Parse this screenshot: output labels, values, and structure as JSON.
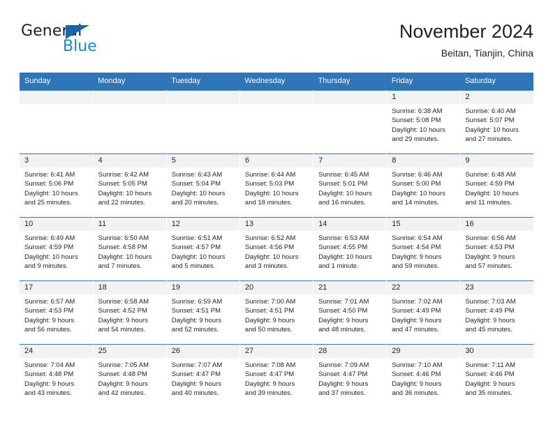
{
  "brand": {
    "name_part1": "General",
    "name_part2": "Blue",
    "color_dark": "#231f20",
    "color_blue": "#1b87c9",
    "triangle_color": "#1668ad"
  },
  "header": {
    "title": "November 2024",
    "subtitle": "Beitan, Tianjin, China"
  },
  "theme": {
    "header_bg": "#2e76b8",
    "daynum_bg": "#f2f2f2",
    "grid_line": "#2e76b8",
    "text": "#231f20"
  },
  "weekdays": [
    {
      "label": "Sunday"
    },
    {
      "label": "Monday"
    },
    {
      "label": "Tuesday"
    },
    {
      "label": "Wednesday"
    },
    {
      "label": "Thursday"
    },
    {
      "label": "Friday"
    },
    {
      "label": "Saturday"
    }
  ],
  "weeks": [
    [
      {
        "day": "",
        "blank": true,
        "sunrise": "",
        "sunset": "",
        "daylight": "",
        "daylight2": ""
      },
      {
        "day": "",
        "blank": true,
        "sunrise": "",
        "sunset": "",
        "daylight": "",
        "daylight2": ""
      },
      {
        "day": "",
        "blank": true,
        "sunrise": "",
        "sunset": "",
        "daylight": "",
        "daylight2": ""
      },
      {
        "day": "",
        "blank": true,
        "sunrise": "",
        "sunset": "",
        "daylight": "",
        "daylight2": ""
      },
      {
        "day": "",
        "blank": true,
        "sunrise": "",
        "sunset": "",
        "daylight": "",
        "daylight2": ""
      },
      {
        "day": "1",
        "blank": false,
        "sunrise": "Sunrise: 6:38 AM",
        "sunset": "Sunset: 5:08 PM",
        "daylight": "Daylight: 10 hours",
        "daylight2": "and 29 minutes."
      },
      {
        "day": "2",
        "blank": false,
        "sunrise": "Sunrise: 6:40 AM",
        "sunset": "Sunset: 5:07 PM",
        "daylight": "Daylight: 10 hours",
        "daylight2": "and 27 minutes."
      }
    ],
    [
      {
        "day": "3",
        "blank": false,
        "sunrise": "Sunrise: 6:41 AM",
        "sunset": "Sunset: 5:06 PM",
        "daylight": "Daylight: 10 hours",
        "daylight2": "and 25 minutes."
      },
      {
        "day": "4",
        "blank": false,
        "sunrise": "Sunrise: 6:42 AM",
        "sunset": "Sunset: 5:05 PM",
        "daylight": "Daylight: 10 hours",
        "daylight2": "and 22 minutes."
      },
      {
        "day": "5",
        "blank": false,
        "sunrise": "Sunrise: 6:43 AM",
        "sunset": "Sunset: 5:04 PM",
        "daylight": "Daylight: 10 hours",
        "daylight2": "and 20 minutes."
      },
      {
        "day": "6",
        "blank": false,
        "sunrise": "Sunrise: 6:44 AM",
        "sunset": "Sunset: 5:03 PM",
        "daylight": "Daylight: 10 hours",
        "daylight2": "and 18 minutes."
      },
      {
        "day": "7",
        "blank": false,
        "sunrise": "Sunrise: 6:45 AM",
        "sunset": "Sunset: 5:01 PM",
        "daylight": "Daylight: 10 hours",
        "daylight2": "and 16 minutes."
      },
      {
        "day": "8",
        "blank": false,
        "sunrise": "Sunrise: 6:46 AM",
        "sunset": "Sunset: 5:00 PM",
        "daylight": "Daylight: 10 hours",
        "daylight2": "and 14 minutes."
      },
      {
        "day": "9",
        "blank": false,
        "sunrise": "Sunrise: 6:48 AM",
        "sunset": "Sunset: 4:59 PM",
        "daylight": "Daylight: 10 hours",
        "daylight2": "and 11 minutes."
      }
    ],
    [
      {
        "day": "10",
        "blank": false,
        "sunrise": "Sunrise: 6:49 AM",
        "sunset": "Sunset: 4:59 PM",
        "daylight": "Daylight: 10 hours",
        "daylight2": "and 9 minutes."
      },
      {
        "day": "11",
        "blank": false,
        "sunrise": "Sunrise: 6:50 AM",
        "sunset": "Sunset: 4:58 PM",
        "daylight": "Daylight: 10 hours",
        "daylight2": "and 7 minutes."
      },
      {
        "day": "12",
        "blank": false,
        "sunrise": "Sunrise: 6:51 AM",
        "sunset": "Sunset: 4:57 PM",
        "daylight": "Daylight: 10 hours",
        "daylight2": "and 5 minutes."
      },
      {
        "day": "13",
        "blank": false,
        "sunrise": "Sunrise: 6:52 AM",
        "sunset": "Sunset: 4:56 PM",
        "daylight": "Daylight: 10 hours",
        "daylight2": "and 3 minutes."
      },
      {
        "day": "14",
        "blank": false,
        "sunrise": "Sunrise: 6:53 AM",
        "sunset": "Sunset: 4:55 PM",
        "daylight": "Daylight: 10 hours",
        "daylight2": "and 1 minute."
      },
      {
        "day": "15",
        "blank": false,
        "sunrise": "Sunrise: 6:54 AM",
        "sunset": "Sunset: 4:54 PM",
        "daylight": "Daylight: 9 hours",
        "daylight2": "and 59 minutes."
      },
      {
        "day": "16",
        "blank": false,
        "sunrise": "Sunrise: 6:56 AM",
        "sunset": "Sunset: 4:53 PM",
        "daylight": "Daylight: 9 hours",
        "daylight2": "and 57 minutes."
      }
    ],
    [
      {
        "day": "17",
        "blank": false,
        "sunrise": "Sunrise: 6:57 AM",
        "sunset": "Sunset: 4:53 PM",
        "daylight": "Daylight: 9 hours",
        "daylight2": "and 56 minutes."
      },
      {
        "day": "18",
        "blank": false,
        "sunrise": "Sunrise: 6:58 AM",
        "sunset": "Sunset: 4:52 PM",
        "daylight": "Daylight: 9 hours",
        "daylight2": "and 54 minutes."
      },
      {
        "day": "19",
        "blank": false,
        "sunrise": "Sunrise: 6:59 AM",
        "sunset": "Sunset: 4:51 PM",
        "daylight": "Daylight: 9 hours",
        "daylight2": "and 52 minutes."
      },
      {
        "day": "20",
        "blank": false,
        "sunrise": "Sunrise: 7:00 AM",
        "sunset": "Sunset: 4:51 PM",
        "daylight": "Daylight: 9 hours",
        "daylight2": "and 50 minutes."
      },
      {
        "day": "21",
        "blank": false,
        "sunrise": "Sunrise: 7:01 AM",
        "sunset": "Sunset: 4:50 PM",
        "daylight": "Daylight: 9 hours",
        "daylight2": "and 48 minutes."
      },
      {
        "day": "22",
        "blank": false,
        "sunrise": "Sunrise: 7:02 AM",
        "sunset": "Sunset: 4:49 PM",
        "daylight": "Daylight: 9 hours",
        "daylight2": "and 47 minutes."
      },
      {
        "day": "23",
        "blank": false,
        "sunrise": "Sunrise: 7:03 AM",
        "sunset": "Sunset: 4:49 PM",
        "daylight": "Daylight: 9 hours",
        "daylight2": "and 45 minutes."
      }
    ],
    [
      {
        "day": "24",
        "blank": false,
        "sunrise": "Sunrise: 7:04 AM",
        "sunset": "Sunset: 4:48 PM",
        "daylight": "Daylight: 9 hours",
        "daylight2": "and 43 minutes."
      },
      {
        "day": "25",
        "blank": false,
        "sunrise": "Sunrise: 7:05 AM",
        "sunset": "Sunset: 4:48 PM",
        "daylight": "Daylight: 9 hours",
        "daylight2": "and 42 minutes."
      },
      {
        "day": "26",
        "blank": false,
        "sunrise": "Sunrise: 7:07 AM",
        "sunset": "Sunset: 4:47 PM",
        "daylight": "Daylight: 9 hours",
        "daylight2": "and 40 minutes."
      },
      {
        "day": "27",
        "blank": false,
        "sunrise": "Sunrise: 7:08 AM",
        "sunset": "Sunset: 4:47 PM",
        "daylight": "Daylight: 9 hours",
        "daylight2": "and 39 minutes."
      },
      {
        "day": "28",
        "blank": false,
        "sunrise": "Sunrise: 7:09 AM",
        "sunset": "Sunset: 4:47 PM",
        "daylight": "Daylight: 9 hours",
        "daylight2": "and 37 minutes."
      },
      {
        "day": "29",
        "blank": false,
        "sunrise": "Sunrise: 7:10 AM",
        "sunset": "Sunset: 4:46 PM",
        "daylight": "Daylight: 9 hours",
        "daylight2": "and 36 minutes."
      },
      {
        "day": "30",
        "blank": false,
        "sunrise": "Sunrise: 7:11 AM",
        "sunset": "Sunset: 4:46 PM",
        "daylight": "Daylight: 9 hours",
        "daylight2": "and 35 minutes."
      }
    ]
  ]
}
